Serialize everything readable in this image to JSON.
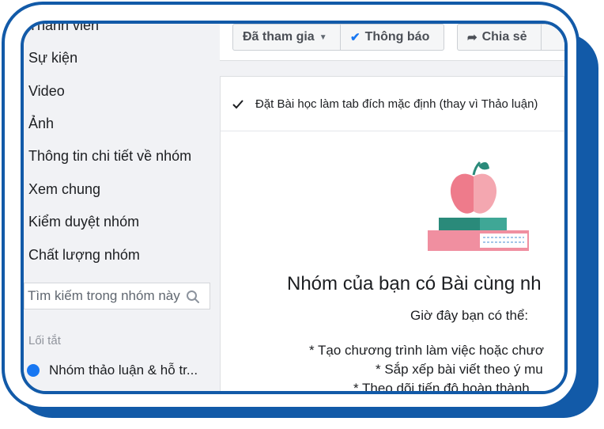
{
  "sidebar": {
    "items": [
      {
        "label": "Thành viên"
      },
      {
        "label": "Sự kiện"
      },
      {
        "label": "Video"
      },
      {
        "label": "Ảnh"
      },
      {
        "label": "Thông tin chi tiết về nhóm"
      },
      {
        "label": "Xem chung"
      },
      {
        "label": "Kiểm duyệt nhóm"
      },
      {
        "label": "Chất lượng nhóm"
      }
    ],
    "search_placeholder": "Tìm kiếm trong nhóm này",
    "shortcuts_label": "Lối tắt",
    "shortcut": {
      "label": "Nhóm thảo luận & hỗ tr..."
    }
  },
  "action_bar": {
    "joined_label": "Đã tham gia",
    "notify_label": "Thông báo",
    "share_label": "Chia sẻ"
  },
  "settings": {
    "default_tab_option": "Đặt Bài học làm tab đích mặc định (thay vì Thảo luận)",
    "default_tab_checked": true
  },
  "empty_state": {
    "title": "Nhóm của bạn có Bài cùng nh",
    "subtitle": "Giờ đây bạn có thể:",
    "bullets": [
      "* Tạo chương trình làm việc hoặc chươ",
      "* Sắp xếp bài viết theo ý mu",
      "* Theo dõi tiến độ hoàn thành"
    ]
  },
  "colors": {
    "frame_blue": "#125aa8",
    "sidebar_bg": "#f1f2f5",
    "notify_check_blue": "#1877f2",
    "apple_pink": "#ee7b8b",
    "book_green": "#2a8a7a"
  }
}
